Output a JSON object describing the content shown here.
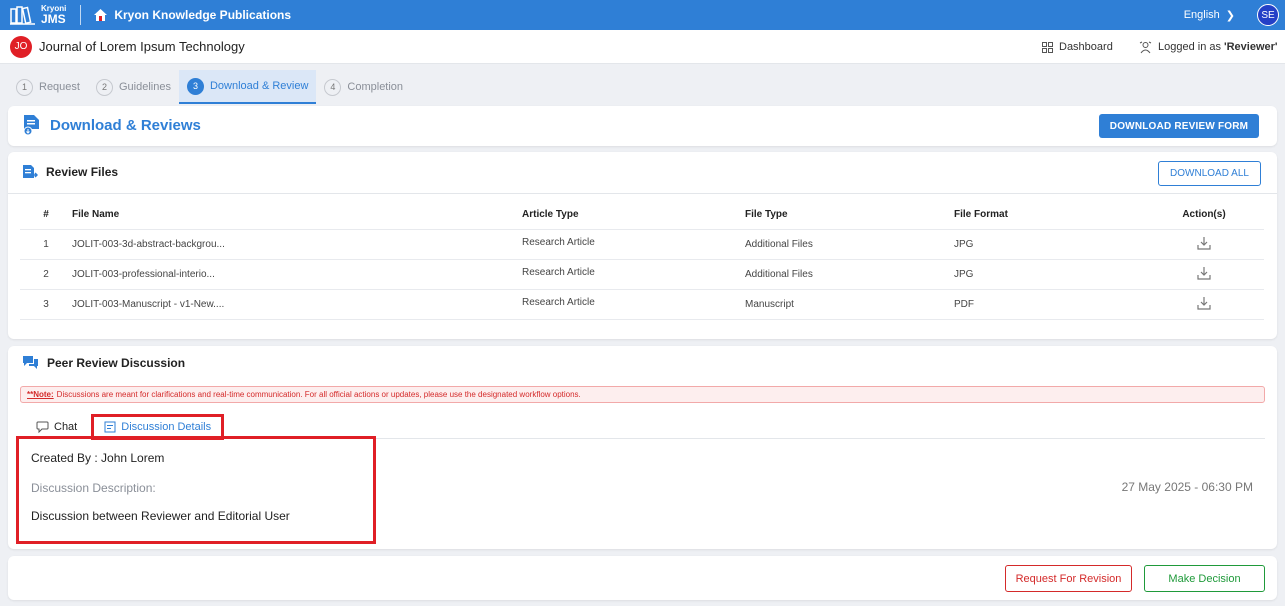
{
  "topbar": {
    "brand_small": "Kryoni",
    "brand_big": "JMS",
    "publication": "Kryon Knowledge Publications",
    "language": "English",
    "user_initials": "SE"
  },
  "journal": {
    "initials": "JO",
    "title": "Journal of Lorem Ipsum Technology",
    "dashboard_label": "Dashboard",
    "logged_prefix": "Logged in as",
    "logged_role": "'Reviewer'"
  },
  "steps": [
    {
      "num": "1",
      "label": "Request"
    },
    {
      "num": "2",
      "label": "Guidelines"
    },
    {
      "num": "3",
      "label": "Download & Review"
    },
    {
      "num": "4",
      "label": "Completion"
    }
  ],
  "header": {
    "title": "Download & Reviews",
    "download_form_label": "DOWNLOAD REVIEW FORM"
  },
  "review_files": {
    "title": "Review Files",
    "download_all_label": "DOWNLOAD ALL",
    "columns": [
      "#",
      "File Name",
      "Article Type",
      "File Type",
      "File Format",
      "Action(s)"
    ],
    "rows": [
      {
        "num": "1",
        "name": "JOLIT-003-3d-abstract-backgrou...",
        "article_type": "Research Article",
        "file_type": "Additional Files",
        "format": "JPG"
      },
      {
        "num": "2",
        "name": "JOLIT-003-professional-interio...",
        "article_type": "Research Article",
        "file_type": "Additional Files",
        "format": "JPG"
      },
      {
        "num": "3",
        "name": "JOLIT-003-Manuscript - v1-New....",
        "article_type": "Research Article",
        "file_type": "Manuscript",
        "format": "PDF"
      }
    ]
  },
  "peer_review": {
    "title": "Peer Review Discussion",
    "note_label": "**Note:",
    "note_text": "Discussions are meant for clarifications and real-time communication. For all official actions or updates, please use the designated workflow options.",
    "tab_chat": "Chat",
    "tab_details": "Discussion Details",
    "created_by": "Created By : John Lorem",
    "description_label": "Discussion Description:",
    "description_value": "Discussion between Reviewer and Editorial User",
    "timestamp": "27 May 2025 - 06:30 PM"
  },
  "footer": {
    "revision_label": "Request For Revision",
    "decision_label": "Make Decision"
  },
  "colors": {
    "primary": "#2f7fd6",
    "danger": "#d42a2a",
    "success": "#1f9a3a"
  }
}
